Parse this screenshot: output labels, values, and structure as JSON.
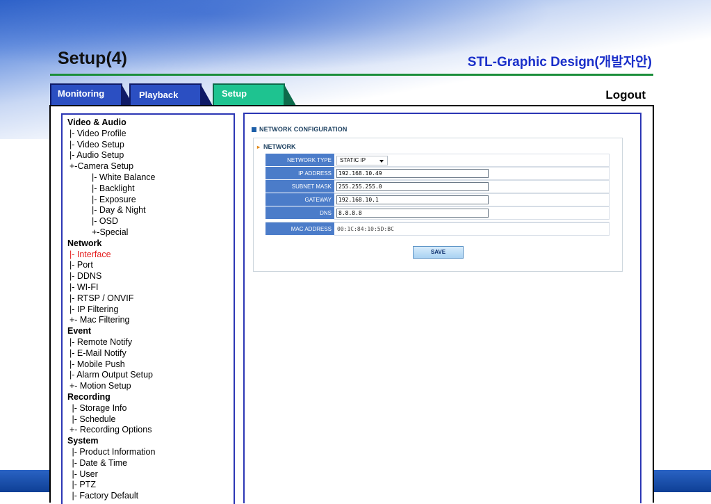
{
  "slide": {
    "title": "Setup(4)",
    "subtitle": "STL-Graphic Design(개발자안)"
  },
  "tabs": {
    "monitoring": "Monitoring",
    "playback": "Playback",
    "setup": "Setup",
    "active": "Setup"
  },
  "logout": "Logout",
  "menu": {
    "video_audio": "Video & Audio",
    "video_profile": "|- Video Profile",
    "video_setup": "|- Video Setup",
    "audio_setup": "|- Audio Setup",
    "camera_setup": "+-Camera Setup",
    "white_balance": "|- White Balance",
    "backlight": "|- Backlight",
    "exposure": "|- Exposure",
    "day_night": "|- Day & Night",
    "osd": "|- OSD",
    "special": "+-Special",
    "network": "Network",
    "interface": "|- Interface",
    "port": "|- Port",
    "ddns": "|- DDNS",
    "wifi": "|- WI-FI",
    "rtsp_onvif": "|- RTSP / ONVIF",
    "ip_filtering": "|- IP Filtering",
    "mac_filtering": "+- Mac Filtering",
    "event": "Event",
    "remote_notify": "|- Remote Notify",
    "email_notify": "|- E-Mail Notify",
    "mobile_push": "|- Mobile Push",
    "alarm_output": "|- Alarm Output Setup",
    "motion_setup": "+- Motion Setup",
    "recording": "Recording",
    "storage_info": " |- Storage Info",
    "schedule": " |- Schedule",
    "recording_options": "+- Recording Options",
    "system": "System",
    "product_info": " |- Product Information",
    "date_time": " |- Date & Time",
    "user": " |- User",
    "ptz": " |- PTZ",
    "factory_default": " |- Factory Default"
  },
  "network_config": {
    "section_title": "NETWORK CONFIGURATION",
    "group_label": "NETWORK",
    "fields": {
      "network_type_label": "NETWORK TYPE",
      "network_type_value": "STATIC IP",
      "ip_label": "IP ADDRESS",
      "ip_value": "192.168.10.49",
      "subnet_label": "SUBNET MASK",
      "subnet_value": "255.255.255.0",
      "gateway_label": "GATEWAY",
      "gateway_value": "192.168.10.1",
      "dns_label": "DNS",
      "dns_value": "8.8.8.8",
      "mac_label": "MAC ADDRESS",
      "mac_value": "00:1C:84:10:5D:BC"
    },
    "save_label": "SAVE"
  },
  "colors": {
    "tab_blue": "#2b4fc2",
    "tab_setup": "#1ec390",
    "active_menu": "#e41c1c",
    "field_label_bg": "#4b7cc9",
    "title_rule": "#1b8e3a",
    "subtitle": "#1a2fc9"
  }
}
